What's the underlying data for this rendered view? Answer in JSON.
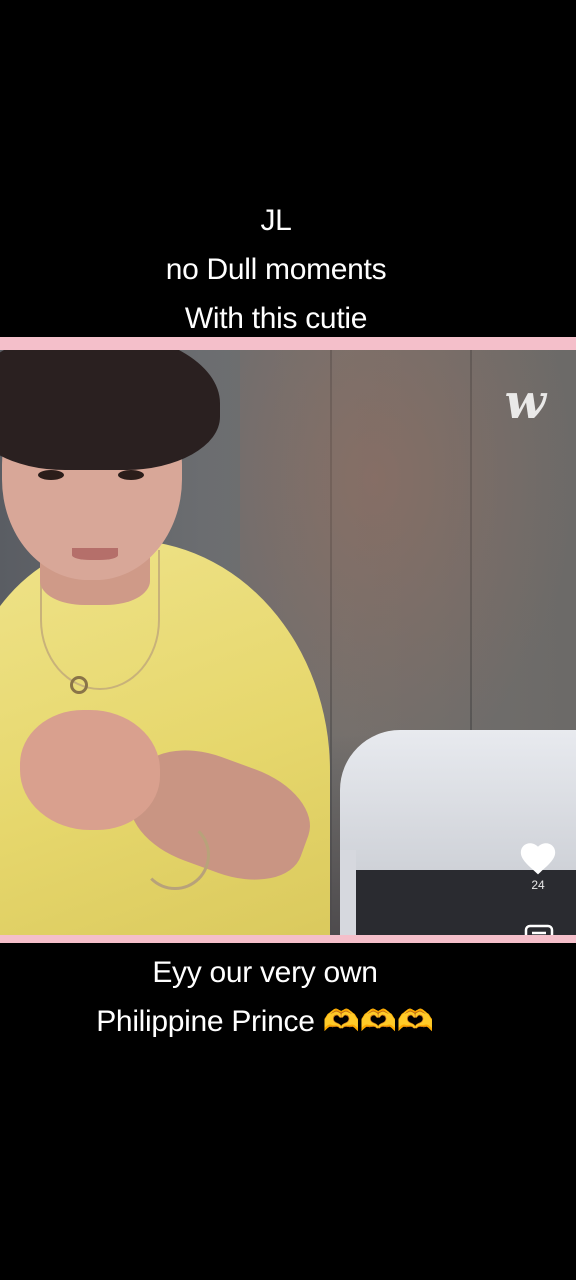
{
  "caption_top": {
    "line1": "JL",
    "line2": "no Dull moments",
    "line3": "With this cutie"
  },
  "video": {
    "watermark": "w",
    "like_count": "24",
    "frame_color": "#f4bfca"
  },
  "icons": {
    "like": "heart-icon",
    "comment": "comment-icon"
  },
  "caption_bottom": {
    "line1": "Eyy our very own",
    "line2": "Philippine Prince 🫶🫶🫶"
  }
}
